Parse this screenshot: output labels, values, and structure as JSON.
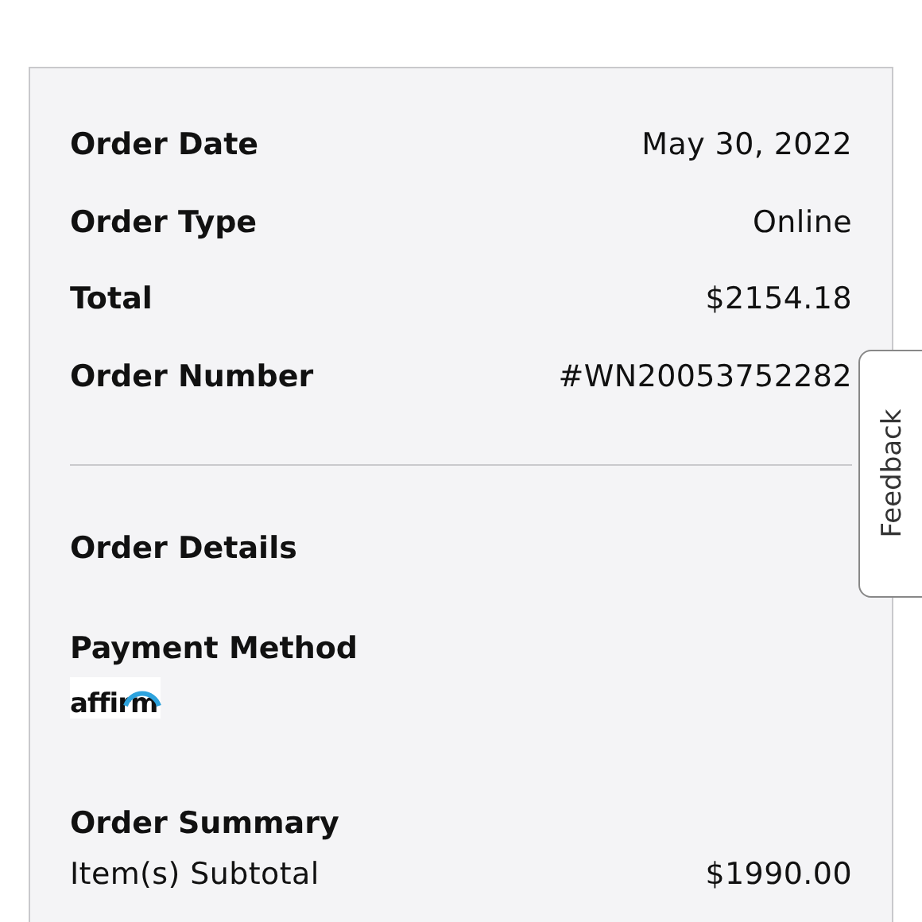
{
  "details": [
    {
      "label": "Order Date",
      "value": "May 30, 2022"
    },
    {
      "label": "Order Type",
      "value": "Online"
    },
    {
      "label": "Total",
      "value": "$2154.18"
    },
    {
      "label": "Order Number",
      "value": "#WN20053752282"
    }
  ],
  "order_details": {
    "title": "Order Details"
  },
  "payment": {
    "title": "Payment Method",
    "logo_text": "affirm"
  },
  "summary": {
    "title": "Order Summary",
    "rows": [
      {
        "label": "Item(s) Subtotal",
        "value": "$1990.00"
      }
    ]
  },
  "feedback_tab": {
    "label": "Feedback"
  }
}
